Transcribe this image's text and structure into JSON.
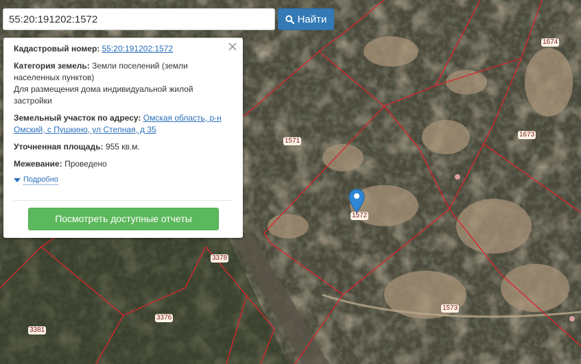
{
  "search": {
    "value": "55:20:191202:1572",
    "button_label": "Найти",
    "button_icon": "search-icon"
  },
  "popup": {
    "cadastral_label": "Кадастровый номер:",
    "cadastral_number": "55:20:191202:1572",
    "land_category_label": "Категория земель:",
    "land_category_value": "Земли поселений (земли населенных пунктов)",
    "land_use": "Для размещения дома индивидуальной жилой застройки",
    "address_label": "Земельный участок по адресу:",
    "address_value": "Омская область, р-н Омский, с Пушкино, ул Степная, д 35",
    "area_label": "Уточненная площадь:",
    "area_value": "955 кв.м.",
    "survey_label": "Межевание:",
    "survey_value": "Проведено",
    "details_label": "Подробно",
    "reports_button": "Посмотреть доступные отчеты"
  },
  "map": {
    "parcel_labels": [
      "1674",
      "1571",
      "1673",
      "1572",
      "3378",
      "3376",
      "3381",
      "1573"
    ],
    "boundary_color": "#d8262c",
    "marker_color": "#2f86d6"
  },
  "colors": {
    "primary_blue": "#337ab7",
    "success_green": "#5cb85c",
    "link": "#2a6fbd"
  }
}
